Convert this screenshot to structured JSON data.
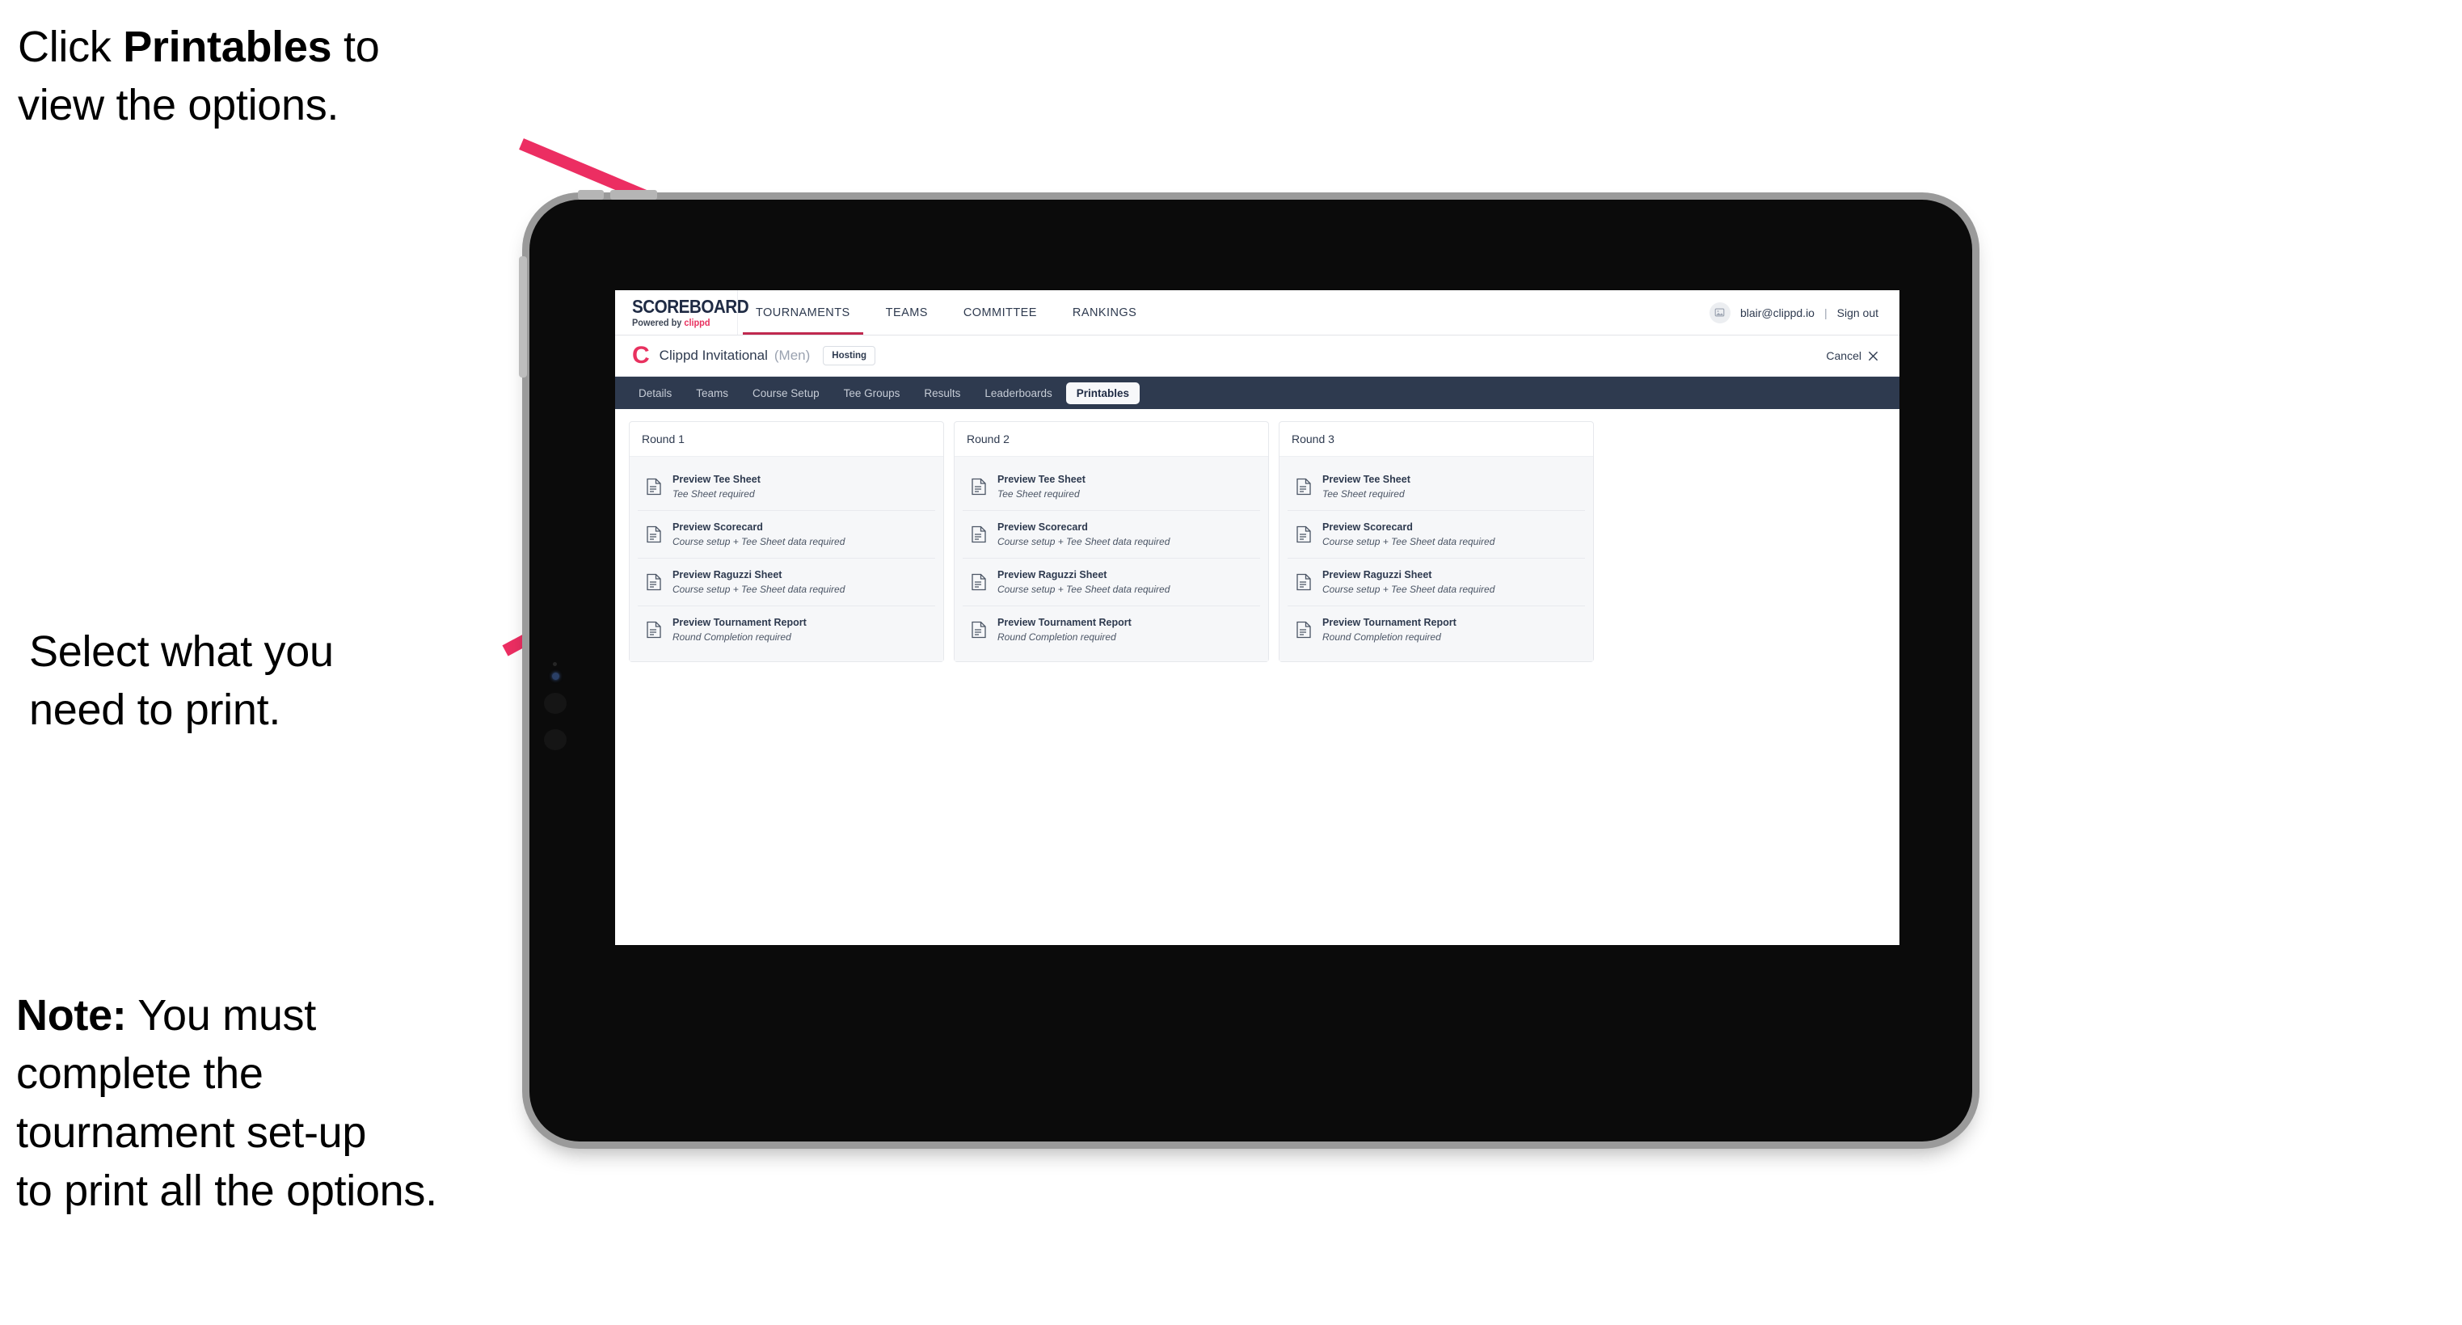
{
  "annotations": {
    "click_printables": {
      "before": "Click ",
      "bold": "Printables",
      "after": " to\nview the options."
    },
    "select_print": "Select what you\n need to print.",
    "note": {
      "bold": "Note:",
      "text": " You must\ncomplete the\ntournament set-up\nto print all the options."
    }
  },
  "colors": {
    "arrow_pink": "#ec2e62",
    "brand_pink": "#e8315f",
    "navy": "#2e3a4f",
    "active_underline": "#c0294f"
  },
  "app": {
    "logo": {
      "word": "SCOREBOARD",
      "powered_prefix": "Powered by ",
      "powered_brand": "clippd"
    },
    "main_nav": [
      {
        "label": "TOURNAMENTS",
        "active": true
      },
      {
        "label": "TEAMS",
        "active": false
      },
      {
        "label": "COMMITTEE",
        "active": false
      },
      {
        "label": "RANKINGS",
        "active": false
      }
    ],
    "account": {
      "avatar_icon": "user-avatar-icon",
      "email": "blair@clippd.io",
      "separator": "|",
      "sign_out": "Sign out"
    },
    "tournament_bar": {
      "logo_mark": "C",
      "name": "Clippd Invitational",
      "gender": "(Men)",
      "status_badge": "Hosting",
      "cancel_label": "Cancel",
      "cancel_icon": "close-x-icon"
    },
    "sub_nav": [
      {
        "label": "Details",
        "active": false
      },
      {
        "label": "Teams",
        "active": false
      },
      {
        "label": "Course Setup",
        "active": false
      },
      {
        "label": "Tee Groups",
        "active": false
      },
      {
        "label": "Results",
        "active": false
      },
      {
        "label": "Leaderboards",
        "active": false
      },
      {
        "label": "Printables",
        "active": true
      }
    ],
    "rounds": [
      {
        "header": "Round 1",
        "items": [
          {
            "icon": "document-icon",
            "title": "Preview Tee Sheet",
            "subtitle": "Tee Sheet required"
          },
          {
            "icon": "document-icon",
            "title": "Preview Scorecard",
            "subtitle": "Course setup + Tee Sheet data required"
          },
          {
            "icon": "document-icon",
            "title": "Preview Raguzzi Sheet",
            "subtitle": "Course setup + Tee Sheet data required"
          },
          {
            "icon": "document-icon",
            "title": "Preview Tournament Report",
            "subtitle": "Round Completion required"
          }
        ]
      },
      {
        "header": "Round 2",
        "items": [
          {
            "icon": "document-icon",
            "title": "Preview Tee Sheet",
            "subtitle": "Tee Sheet required"
          },
          {
            "icon": "document-icon",
            "title": "Preview Scorecard",
            "subtitle": "Course setup + Tee Sheet data required"
          },
          {
            "icon": "document-icon",
            "title": "Preview Raguzzi Sheet",
            "subtitle": "Course setup + Tee Sheet data required"
          },
          {
            "icon": "document-icon",
            "title": "Preview Tournament Report",
            "subtitle": "Round Completion required"
          }
        ]
      },
      {
        "header": "Round 3",
        "items": [
          {
            "icon": "document-icon",
            "title": "Preview Tee Sheet",
            "subtitle": "Tee Sheet required"
          },
          {
            "icon": "document-icon",
            "title": "Preview Scorecard",
            "subtitle": "Course setup + Tee Sheet data required"
          },
          {
            "icon": "document-icon",
            "title": "Preview Raguzzi Sheet",
            "subtitle": "Course setup + Tee Sheet data required"
          },
          {
            "icon": "document-icon",
            "title": "Preview Tournament Report",
            "subtitle": "Round Completion required"
          }
        ]
      }
    ]
  }
}
